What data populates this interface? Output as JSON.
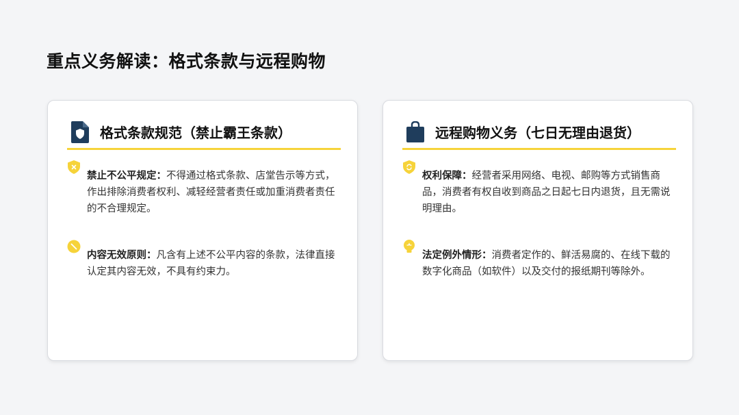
{
  "page": {
    "title": "重点义务解读：格式条款与远程购物"
  },
  "cards": [
    {
      "title": "格式条款规范（禁止霸王条款）",
      "icon": "shield-document-icon",
      "items": [
        {
          "icon": "shield-x-icon",
          "label": "禁止不公平规定：",
          "text": "不得通过格式条款、店堂告示等方式，作出排除消费者权利、减轻经营者责任或加重消费者责任的不合理规定。"
        },
        {
          "icon": "ban-icon",
          "label": "内容无效原则：",
          "text": "凡含有上述不公平内容的条款，法律直接认定其内容无效，不具有约束力。"
        }
      ]
    },
    {
      "title": "远程购物义务（七日无理由退货）",
      "icon": "shopping-bag-icon",
      "items": [
        {
          "icon": "shield-refresh-icon",
          "label": "权利保障：",
          "text": "经营者采用网络、电视、邮购等方式销售商品，消费者有权自收到商品之日起七日内退货，且无需说明理由。"
        },
        {
          "icon": "lightbulb-icon",
          "label": "法定例外情形：",
          "text": "消费者定作的、鲜活易腐的、在线下载的数字化商品（如软件）以及交付的报纸期刊等除外。"
        }
      ]
    }
  ],
  "colors": {
    "accent": "#f6d33a",
    "icon_dark": "#1f3d5c",
    "background": "#f4f5f7"
  }
}
